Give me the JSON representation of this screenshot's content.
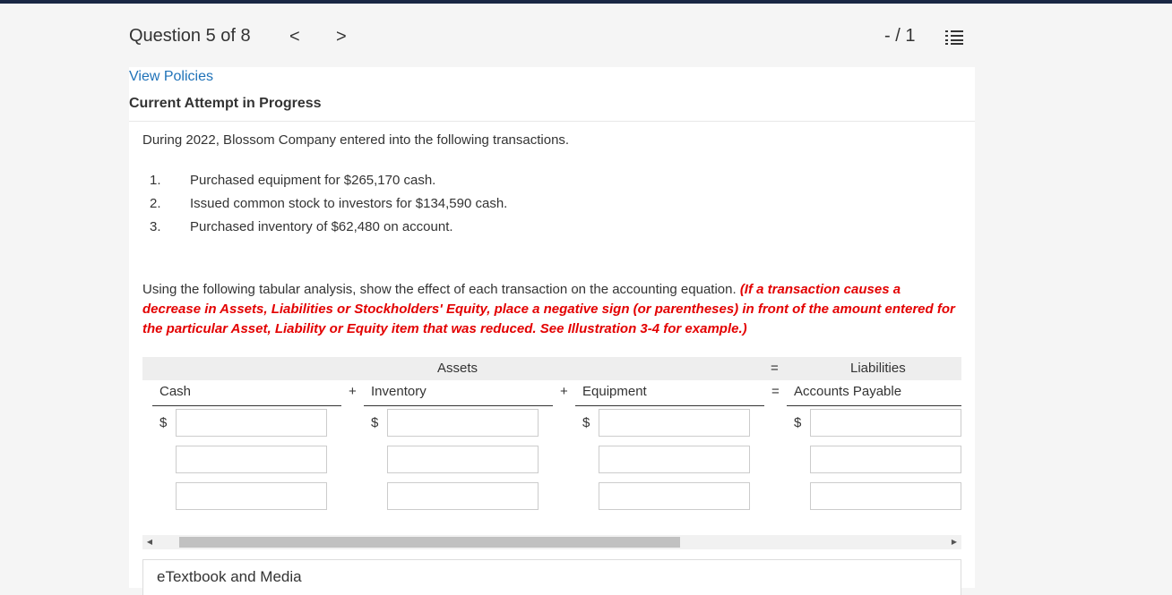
{
  "header": {
    "question_label": "Question 5 of 8",
    "prev": "<",
    "next": ">",
    "score": "- / 1",
    "list_icon": "list-icon"
  },
  "links": {
    "view_policies": "View Policies"
  },
  "attempt_label": "Current Attempt in Progress",
  "question": {
    "intro": "During 2022, Blossom Company entered into the following transactions.",
    "transactions": [
      {
        "num": "1.",
        "text": "Purchased equipment for $265,170 cash."
      },
      {
        "num": "2.",
        "text": "Issued common stock to investors for $134,590 cash."
      },
      {
        "num": "3.",
        "text": "Purchased inventory of $62,480 on account."
      }
    ],
    "instruction_plain": "Using the following tabular analysis, show the effect of each transaction on the accounting equation. ",
    "instruction_red": "(If a transaction causes a decrease in Assets, Liabilities or Stockholders' Equity, place a negative sign (or parentheses) in front of the amount entered for the particular Asset, Liability or Equity item that was reduced. See Illustration 3-4 for example.)"
  },
  "table": {
    "group_assets": "Assets",
    "group_equals": "=",
    "group_liabilities": "Liabilities",
    "columns": [
      {
        "op": "",
        "label": "Cash"
      },
      {
        "op": "+",
        "label": "Inventory"
      },
      {
        "op": "+",
        "label": "Equipment"
      },
      {
        "op": "=",
        "label": "Accounts Payable"
      }
    ],
    "currency_symbol": "$",
    "rows": [
      [
        "",
        "",
        "",
        ""
      ],
      [
        "",
        "",
        "",
        ""
      ],
      [
        "",
        "",
        "",
        ""
      ]
    ]
  },
  "etextbook_label": "eTextbook and Media",
  "colors": {
    "accent_link": "#1f72b8",
    "instruction_red": "#e30000",
    "top_bar": "#1a2744"
  }
}
